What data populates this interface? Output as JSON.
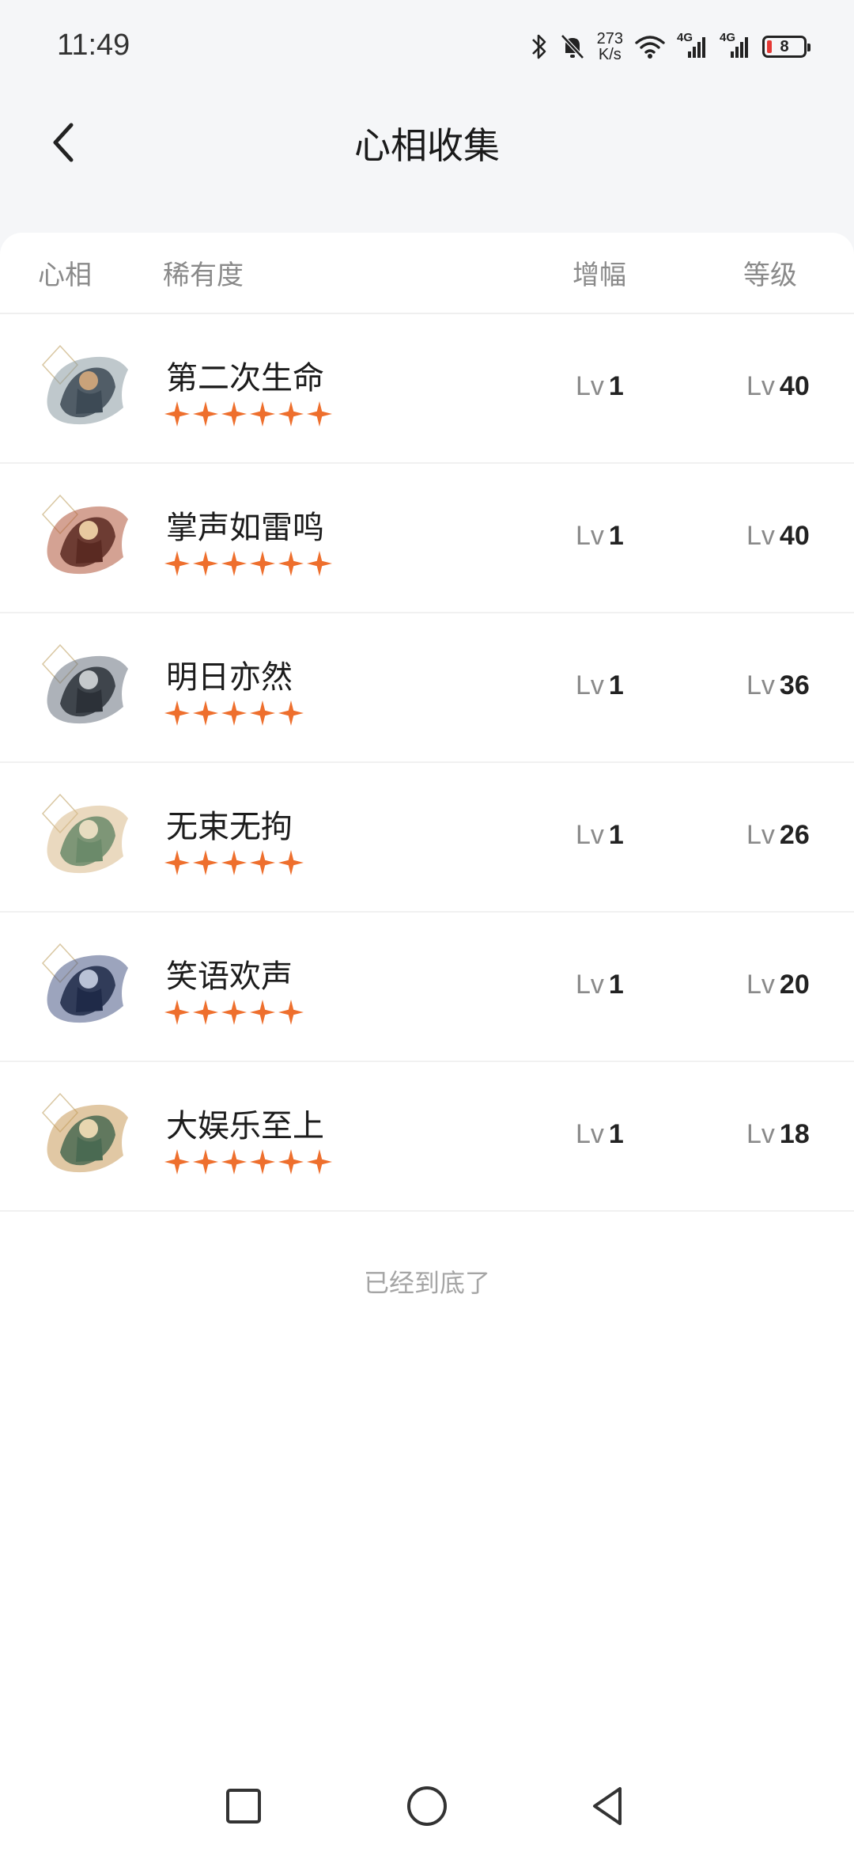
{
  "status_bar": {
    "time": "11:49",
    "net_speed_value": "273",
    "net_speed_unit": "K/s",
    "signal_1_label": "4G",
    "signal_2_label": "4G",
    "battery_level": "8",
    "icons": [
      "bluetooth-icon",
      "bell-muted-icon",
      "wifi-icon",
      "signal-icon",
      "signal-icon",
      "battery-icon"
    ]
  },
  "header": {
    "title": "心相收集",
    "back_icon": "chevron-left-icon"
  },
  "columns": {
    "name": "心相",
    "rarity": "稀有度",
    "boost": "增幅",
    "level": "等级"
  },
  "lv_prefix": "Lv",
  "star_color": "#ee6f2d",
  "rows": [
    {
      "name": "第二次生命",
      "stars": 6,
      "boost": "1",
      "level": "40"
    },
    {
      "name": "掌声如雷鸣",
      "stars": 6,
      "boost": "1",
      "level": "40"
    },
    {
      "name": "明日亦然",
      "stars": 5,
      "boost": "1",
      "level": "36"
    },
    {
      "name": "无束无拘",
      "stars": 5,
      "boost": "1",
      "level": "26"
    },
    {
      "name": "笑语欢声",
      "stars": 5,
      "boost": "1",
      "level": "20"
    },
    {
      "name": "大娱乐至上",
      "stars": 6,
      "boost": "1",
      "level": "18"
    }
  ],
  "footer_note": "已经到底了",
  "nav": {
    "icons": [
      "recents-square-icon",
      "home-circle-icon",
      "back-triangle-icon"
    ]
  }
}
